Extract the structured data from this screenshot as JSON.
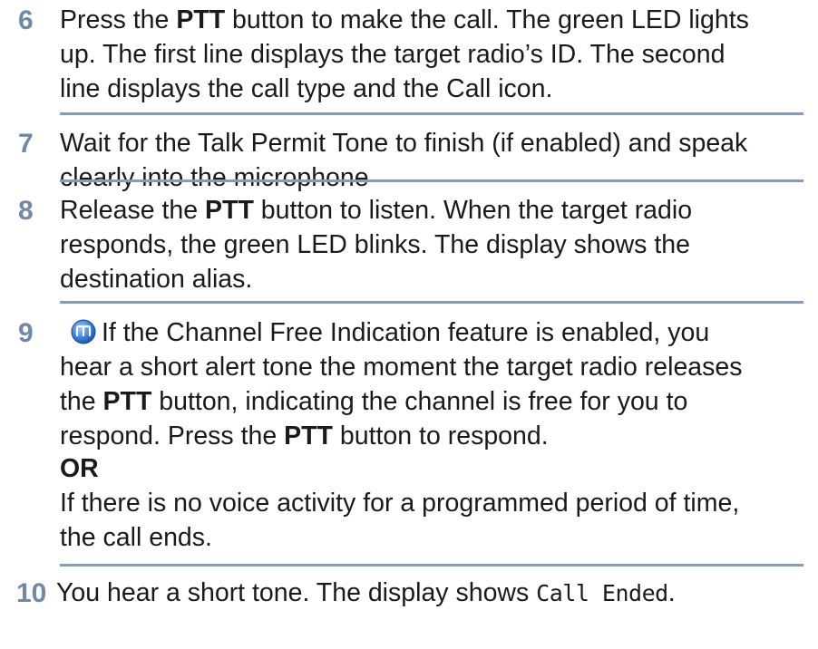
{
  "steps": [
    {
      "number": "6",
      "lines": [
        {
          "parts": [
            "Press the ",
            "PTT",
            " button to make the call. The green LED lights"
          ]
        },
        {
          "text": "up. The first line displays the target radio’s ID. The second"
        },
        {
          "text": "line displays the call type and the Call icon."
        }
      ]
    },
    {
      "number": "7",
      "lines": [
        {
          "text": "Wait for the Talk Permit Tone to finish (if enabled) and speak"
        },
        {
          "text": "clearly into the microphone"
        }
      ]
    },
    {
      "number": "8",
      "lines": [
        {
          "parts": [
            "Release the ",
            "PTT",
            " button to listen. When the target radio"
          ]
        },
        {
          "text": "responds, the green LED blinks. The display shows the"
        },
        {
          "text": "destination alias."
        }
      ]
    },
    {
      "number": "9",
      "icon": "channel-free-indication-icon",
      "lines": [
        {
          "text": "If the Channel Free Indication feature is enabled, you"
        },
        {
          "text": "hear a short alert tone the moment the target radio releases"
        },
        {
          "parts": [
            "the ",
            "PTT",
            " button, indicating the channel is free for you to"
          ]
        },
        {
          "parts": [
            "respond. Press the ",
            "PTT",
            " button to respond."
          ]
        },
        {
          "text": "OR"
        },
        {
          "text": "If there is no voice activity for a programmed period of time,"
        },
        {
          "text": "the call ends."
        }
      ]
    },
    {
      "number": "10",
      "lines": [
        {
          "parts": [
            "You hear a short tone. The display shows ",
            "Call Ended",
            "."
          ]
        }
      ]
    }
  ],
  "colors": {
    "step_number": "#7189a6",
    "rule": "#8a9cb4",
    "text": "#1a1a1a",
    "icon_fill": "#3d7fd6"
  }
}
